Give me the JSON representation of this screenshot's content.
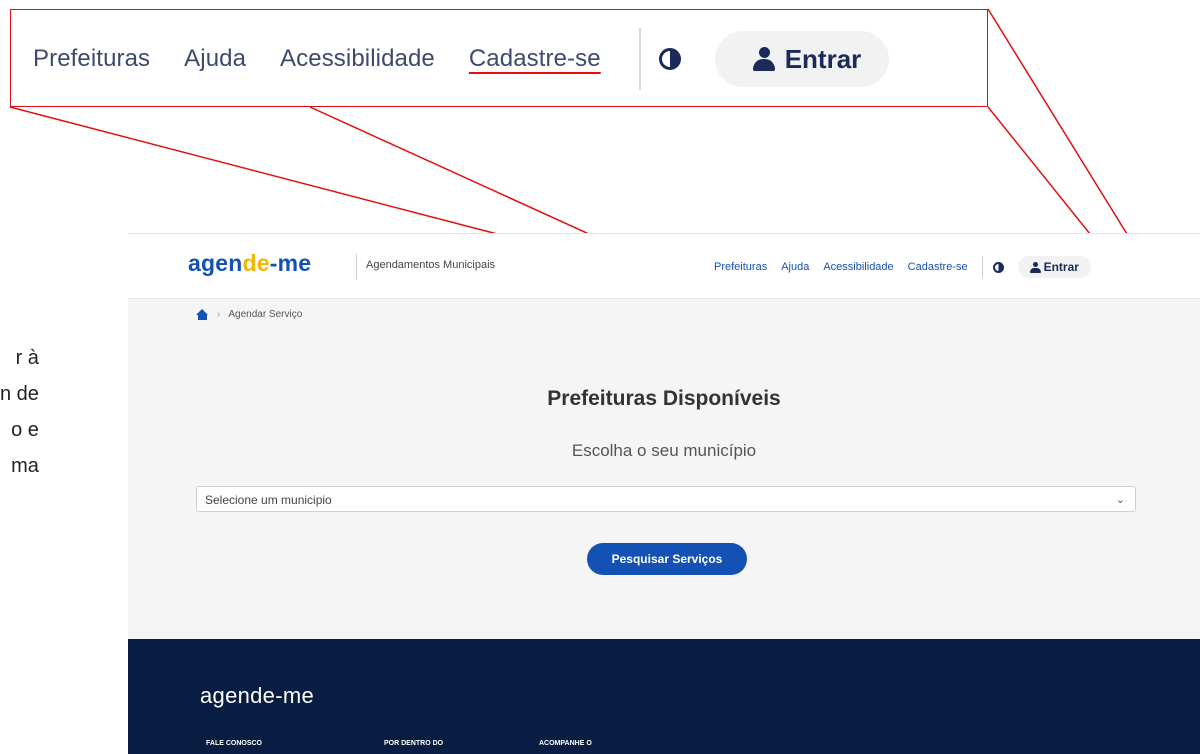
{
  "zoom_nav": {
    "links": [
      "Prefeituras",
      "Ajuda",
      "Acessibilidade",
      "Cadastre-se"
    ],
    "login": "Entrar"
  },
  "left_fragment": [
    "r à",
    "n de",
    "o e",
    "ma"
  ],
  "header": {
    "logo": {
      "part1": "agen",
      "part2": "de",
      "part3": "-me"
    },
    "subtitle": "Agendamentos Municipais",
    "nav": [
      "Prefeituras",
      "Ajuda",
      "Acessibilidade",
      "Cadastre-se"
    ],
    "login": "Entrar"
  },
  "breadcrumb": {
    "current": "Agendar Serviço"
  },
  "main": {
    "title": "Prefeituras Disponíveis",
    "subtitle": "Escolha o seu município",
    "select_placeholder": "Selecione um municipio",
    "search_button": "Pesquisar Serviços"
  },
  "footer": {
    "logo": "agende-me",
    "columns": [
      "FALE CONOSCO",
      "POR DENTRO DO",
      "ACOMPANHE O"
    ]
  },
  "colors": {
    "brand_blue": "#1451b4",
    "brand_yellow": "#f3b700",
    "footer_bg": "#071d41",
    "callout_red": "#e01010"
  }
}
